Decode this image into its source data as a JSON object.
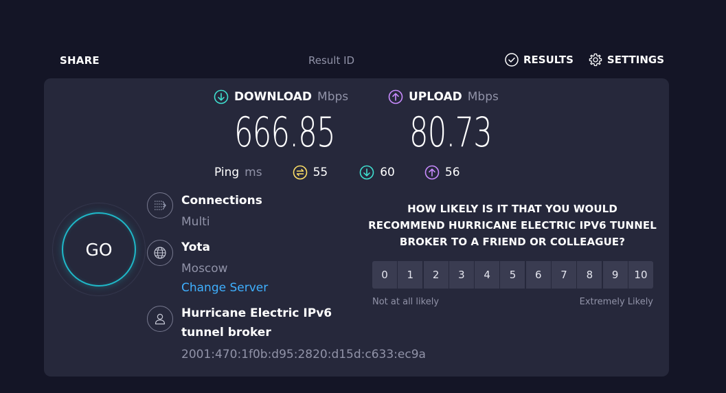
{
  "header": {
    "share_label": "SHARE",
    "result_id_label": "Result ID",
    "results_label": "RESULTS",
    "settings_label": "SETTINGS"
  },
  "download": {
    "label": "DOWNLOAD",
    "unit": "Mbps",
    "value": "666.85",
    "icon": "download-arrow-icon",
    "color": "#3fe0d0"
  },
  "upload": {
    "label": "UPLOAD",
    "unit": "Mbps",
    "value": "80.73",
    "icon": "upload-arrow-icon",
    "color": "#c98bff"
  },
  "ping": {
    "label": "Ping",
    "unit": "ms",
    "idle": "55",
    "download": "60",
    "upload": "56",
    "idle_color": "#ffe066"
  },
  "go_label": "GO",
  "connections": {
    "title": "Connections",
    "value": "Multi"
  },
  "server": {
    "name": "Yota",
    "location": "Moscow",
    "change_label": "Change Server"
  },
  "provider": {
    "name_line1": "Hurricane Electric IPv6",
    "name_line2": "tunnel broker",
    "ip": "2001:470:1f0b:d95:2820:d15d:c633:ec9a"
  },
  "survey": {
    "question": "HOW LIKELY IS IT THAT YOU WOULD RECOMMEND HURRICANE ELECTRIC IPV6 TUNNEL BROKER TO A FRIEND OR COLLEAGUE?",
    "scale": [
      "0",
      "1",
      "2",
      "3",
      "4",
      "5",
      "6",
      "7",
      "8",
      "9",
      "10"
    ],
    "low_label": "Not at all likely",
    "high_label": "Extremely Likely"
  }
}
